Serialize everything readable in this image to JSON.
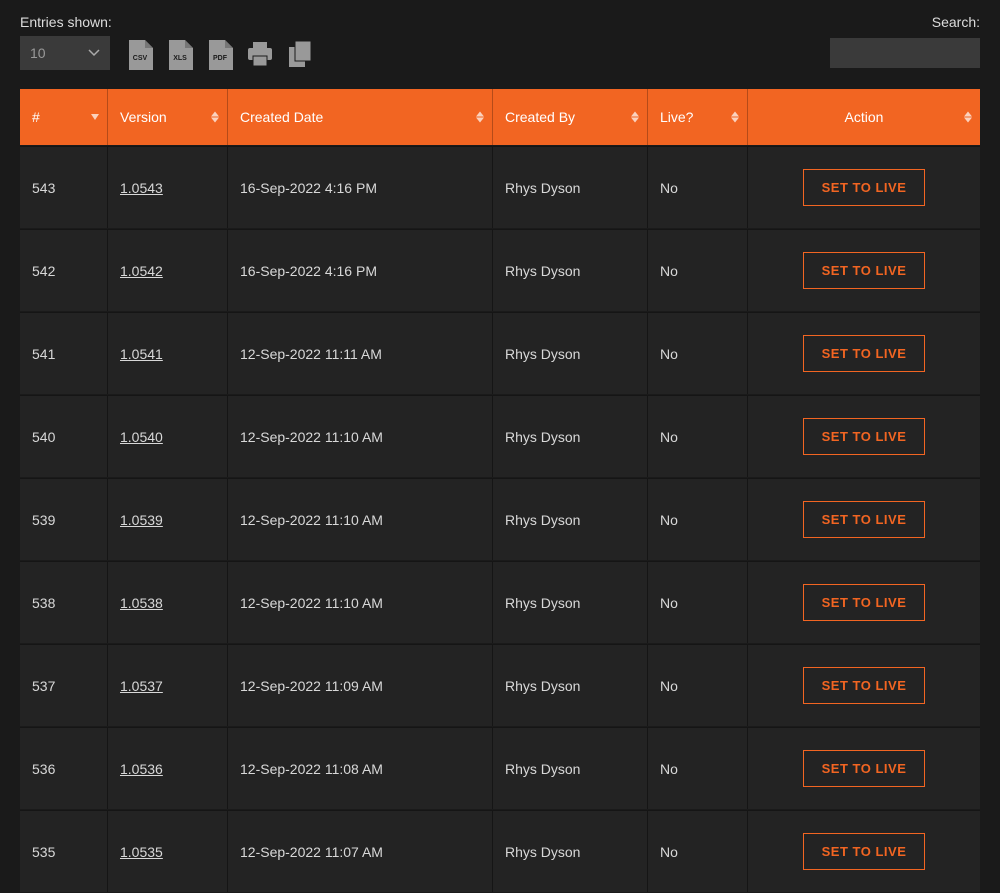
{
  "toolbar": {
    "entries_label": "Entries shown:",
    "entries_value": "10",
    "search_label": "Search:",
    "search_value": "",
    "export": {
      "csv": "CSV",
      "xls": "XLS",
      "pdf": "PDF"
    }
  },
  "table": {
    "columns": {
      "num": "#",
      "version": "Version",
      "created_date": "Created Date",
      "created_by": "Created By",
      "live": "Live?",
      "action": "Action"
    },
    "action_label": "SET TO LIVE",
    "rows": [
      {
        "num": "543",
        "version": "1.0543",
        "created_date": "16-Sep-2022 4:16 PM",
        "created_by": "Rhys Dyson",
        "live": "No"
      },
      {
        "num": "542",
        "version": "1.0542",
        "created_date": "16-Sep-2022 4:16 PM",
        "created_by": "Rhys Dyson",
        "live": "No"
      },
      {
        "num": "541",
        "version": "1.0541",
        "created_date": "12-Sep-2022 11:11 AM",
        "created_by": "Rhys Dyson",
        "live": "No"
      },
      {
        "num": "540",
        "version": "1.0540",
        "created_date": "12-Sep-2022 11:10 AM",
        "created_by": "Rhys Dyson",
        "live": "No"
      },
      {
        "num": "539",
        "version": "1.0539",
        "created_date": "12-Sep-2022 11:10 AM",
        "created_by": "Rhys Dyson",
        "live": "No"
      },
      {
        "num": "538",
        "version": "1.0538",
        "created_date": "12-Sep-2022 11:10 AM",
        "created_by": "Rhys Dyson",
        "live": "No"
      },
      {
        "num": "537",
        "version": "1.0537",
        "created_date": "12-Sep-2022 11:09 AM",
        "created_by": "Rhys Dyson",
        "live": "No"
      },
      {
        "num": "536",
        "version": "1.0536",
        "created_date": "12-Sep-2022 11:08 AM",
        "created_by": "Rhys Dyson",
        "live": "No"
      },
      {
        "num": "535",
        "version": "1.0535",
        "created_date": "12-Sep-2022 11:07 AM",
        "created_by": "Rhys Dyson",
        "live": "No"
      }
    ]
  }
}
